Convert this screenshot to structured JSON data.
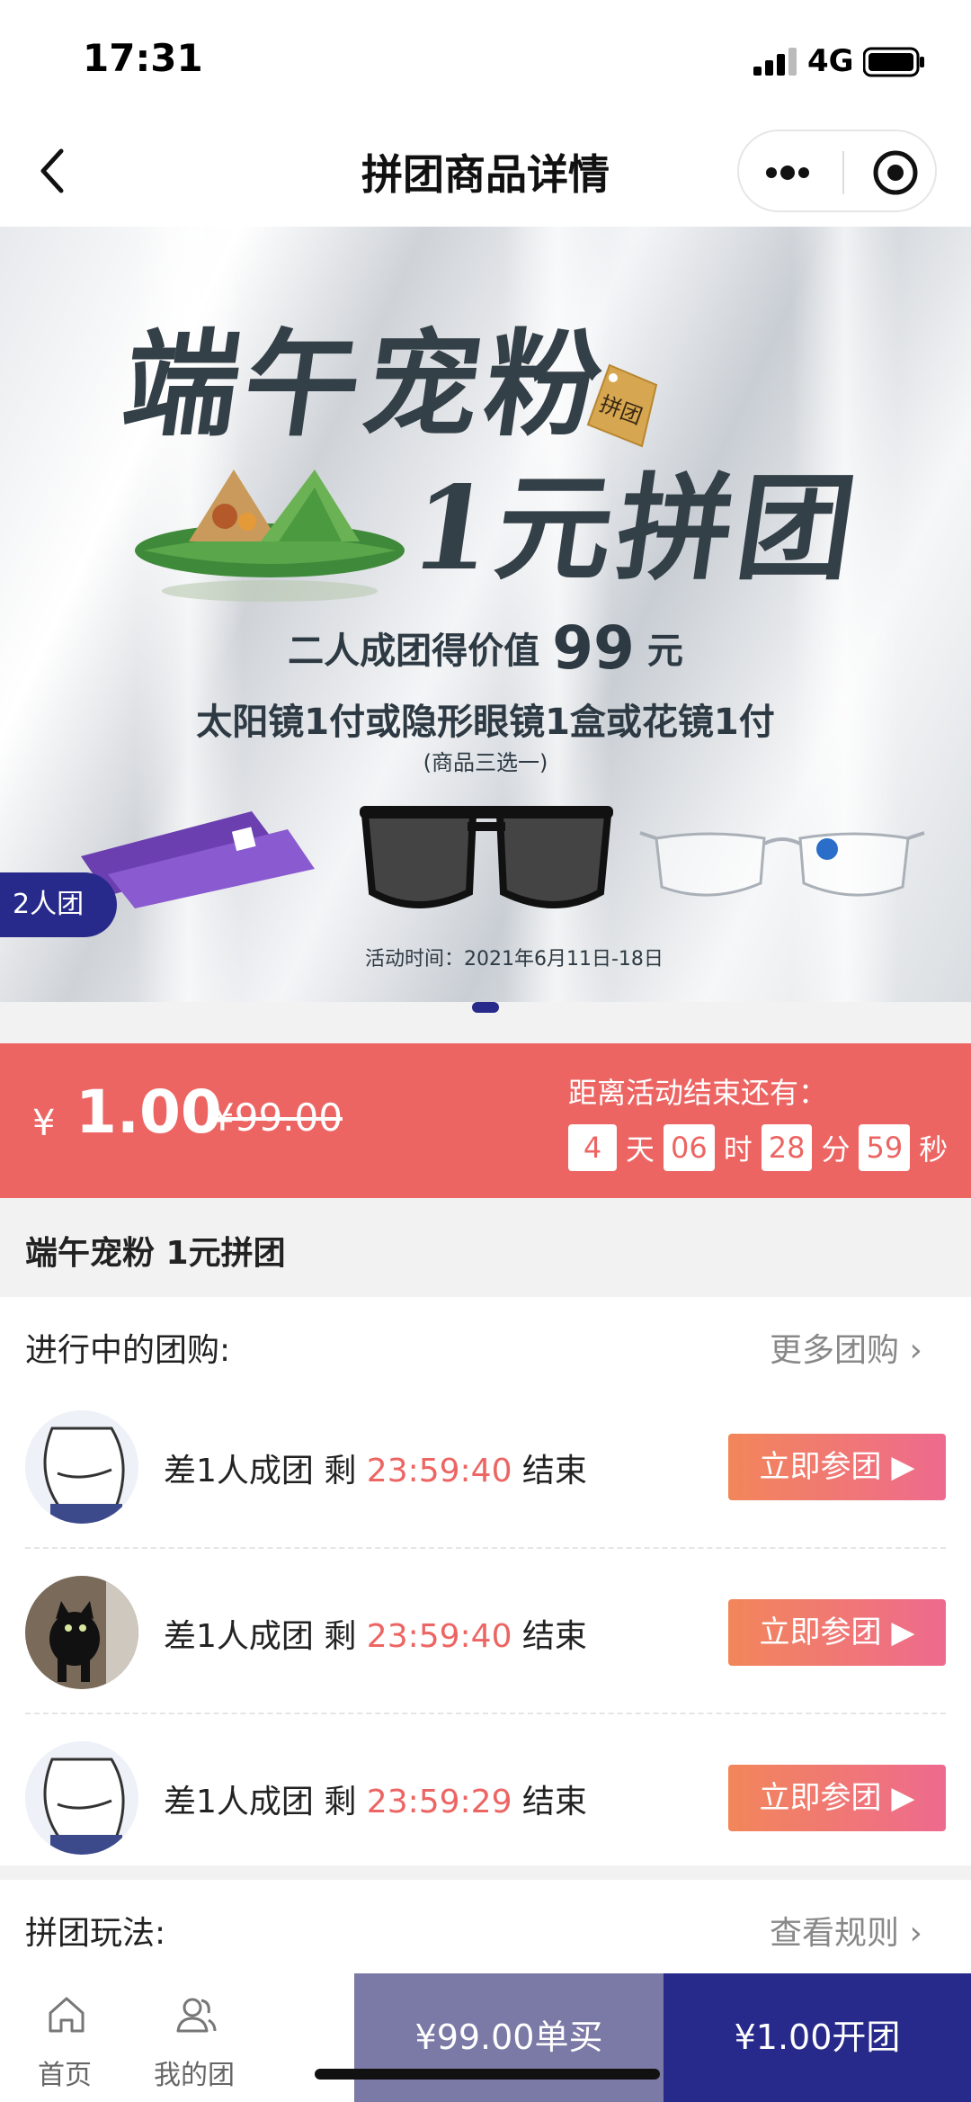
{
  "status_bar": {
    "time": "17:31",
    "network": "4G"
  },
  "nav": {
    "title": "拼团商品详情"
  },
  "banner": {
    "title_line1": "端午宠粉",
    "title_line2": "1元拼团",
    "tag": "拼团",
    "line1_prefix": "二人成团得价值",
    "line1_value": "99",
    "line1_suffix": "元",
    "line2": "太阳镜1付或隐形眼镜1盒或花镜1付",
    "line3": "(商品三选一)",
    "activity_time": "活动时间：2021年6月11日-18日",
    "group_size_badge": "2人团"
  },
  "price": {
    "symbol": "¥",
    "current": "1.00",
    "original": "¥99.00",
    "countdown_label": "距离活动结束还有：",
    "days": "4",
    "day_unit": "天",
    "hours": "06",
    "hour_unit": "时",
    "minutes": "28",
    "minute_unit": "分",
    "seconds": "59",
    "second_unit": "秒"
  },
  "product": {
    "name": "端午宠粉 1元拼团"
  },
  "groups": {
    "title": "进行中的团购:",
    "more": "更多团购 ›",
    "items": [
      {
        "text": "差1人成团 剩 ",
        "time": "23:59:40",
        "end": " 结束",
        "button": "立即参团 ▶",
        "avatar": "belly-avatar"
      },
      {
        "text": "差1人成团 剩 ",
        "time": "23:59:40",
        "end": " 结束",
        "button": "立即参团 ▶",
        "avatar": "cat-avatar"
      },
      {
        "text": "差1人成团 剩 ",
        "time": "23:59:29",
        "end": " 结束",
        "button": "立即参团 ▶",
        "avatar": "belly-avatar"
      }
    ]
  },
  "rules": {
    "title": "拼团玩法:",
    "link": "查看规则 ›"
  },
  "tabbar": {
    "home": "首页",
    "my_group": "我的团",
    "buy_single": "¥99.00单买",
    "open_group": "¥1.00开团"
  },
  "colors": {
    "accent_red": "#ec6563",
    "brand_navy": "#272a8a",
    "single_buy": "#7b79a6"
  }
}
